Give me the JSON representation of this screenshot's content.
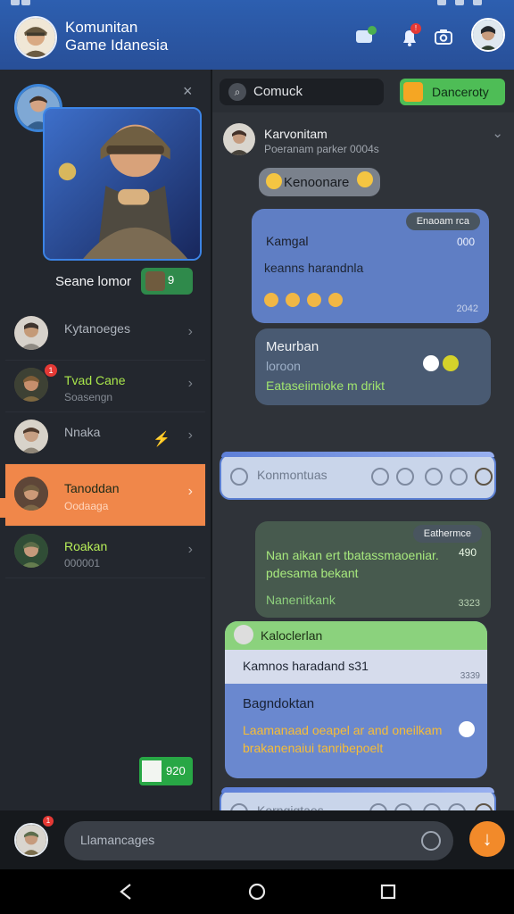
{
  "header": {
    "title_line1": "Komunitan",
    "title_line2": "Game Idanesia",
    "badge_count": "!",
    "colors": {
      "primary": "#2d5fb0",
      "accent": "#f0874a",
      "success": "#4ebd56"
    }
  },
  "left_panel": {
    "hero_name": "Seane lomor",
    "hero_badge": "9",
    "items": [
      {
        "name": "Kytanoeges",
        "sub": "",
        "badge": ""
      },
      {
        "name": "Tvad Cane",
        "sub": "Soasengn",
        "badge": "1"
      },
      {
        "name": "Nnaka",
        "sub": "",
        "badge": ""
      },
      {
        "name": "Tanoddan",
        "sub": "Oodaaga",
        "badge": ""
      },
      {
        "name": "Roakan",
        "sub": "000001",
        "badge": ""
      }
    ],
    "green_button": "920"
  },
  "chat": {
    "search_label": "Comuck",
    "primary_label": "Danceroty",
    "sender_name": "Karvonitam",
    "sender_meta": "Poeranam parker 0004s",
    "chip_label": "Kenoonare",
    "msg1_tag": "Enaoam rca",
    "msg1_title": "Kamgal",
    "msg1_num": "000",
    "msg1_line": "keanns harandnla",
    "msg1_time": "2042",
    "msg2_title": "Meurban",
    "msg2_sub": "loroon",
    "msg2_link": "Eataseiimioke m drikt",
    "composer_placeholder1": "Konmontuas",
    "msg3_tag": "Eathermce",
    "msg3_text": "Nan aikan ert tbatassmaoeniar. pdesama bekant",
    "msg3_num": "490",
    "msg3_sub": "Nanenitkank",
    "msg3_time": "3323",
    "msg4_sender": "Kaloclerlan",
    "msg4_quote": "Kamnos haradand s31",
    "msg4_quote_time": "3339",
    "msg4_title": "Bagndoktan",
    "msg4_text": "Laamanaad oeapel ar and oneilkam brakanenaiui tanribepoelt",
    "composer_placeholder2": "Korngigtaes"
  },
  "bottom": {
    "input_placeholder": "Llamancages",
    "notification_badge": "1"
  }
}
